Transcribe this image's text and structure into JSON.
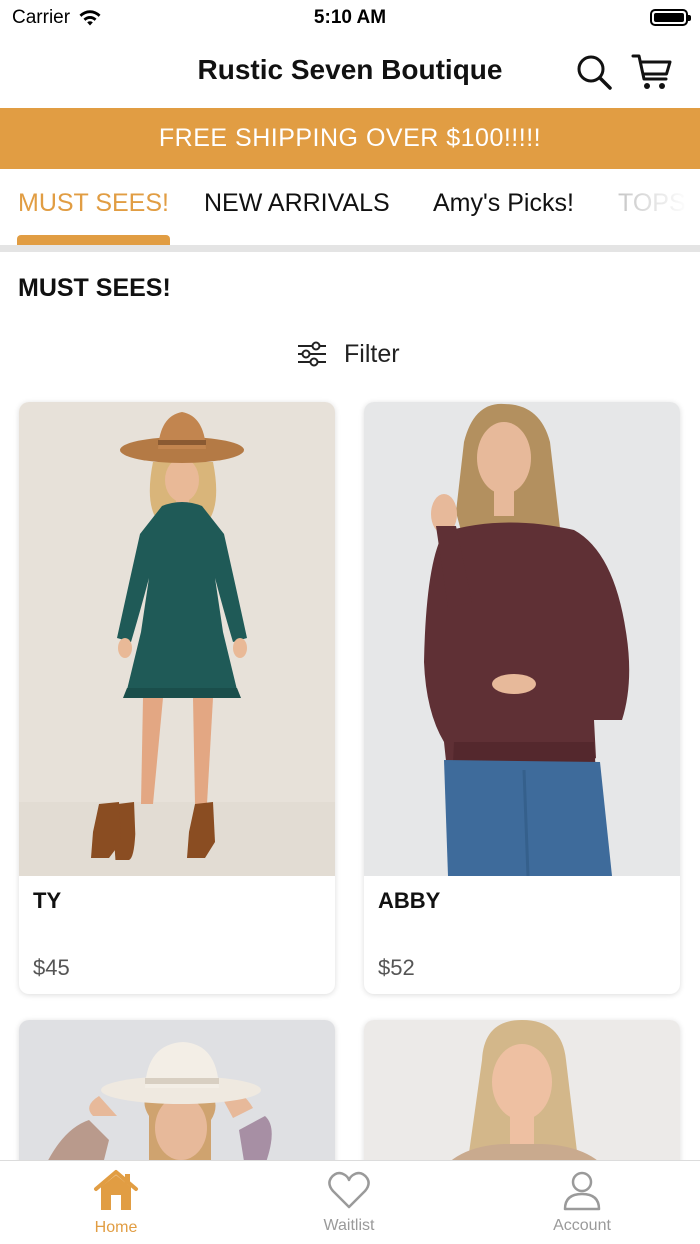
{
  "status_bar": {
    "carrier": "Carrier",
    "time": "5:10 AM"
  },
  "header": {
    "title": "Rustic Seven Boutique",
    "icons": [
      "search-icon",
      "cart-icon"
    ]
  },
  "promo": {
    "text": "FREE SHIPPING OVER $100!!!!!"
  },
  "tabs": [
    {
      "label": "MUST SEES!",
      "active": true
    },
    {
      "label": "NEW ARRIVALS",
      "active": false
    },
    {
      "label": "Amy's Picks!",
      "active": false
    },
    {
      "label": "TOPS",
      "active": false
    }
  ],
  "section": {
    "title": "MUST SEES!",
    "filter_label": "Filter"
  },
  "products": [
    {
      "name": "TY",
      "price": "$45"
    },
    {
      "name": "ABBY",
      "price": "$52"
    },
    {
      "name": "",
      "price": ""
    },
    {
      "name": "",
      "price": ""
    }
  ],
  "tab_bar": [
    {
      "label": "Home",
      "icon": "home-icon",
      "active": true
    },
    {
      "label": "Waitlist",
      "icon": "heart-icon",
      "active": false
    },
    {
      "label": "Account",
      "icon": "user-icon",
      "active": false
    }
  ],
  "colors": {
    "accent": "#E19D43",
    "inactive": "#9a9a9a",
    "text": "#111111"
  }
}
